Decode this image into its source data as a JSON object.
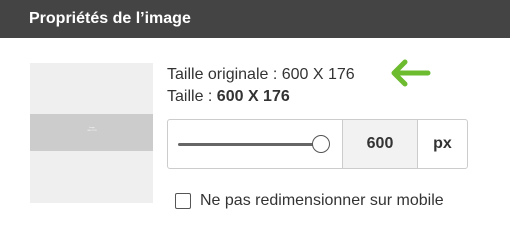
{
  "dialog": {
    "title": "Propriétés de l’image"
  },
  "preview": {
    "line1": "Image",
    "line2": "600 X 176"
  },
  "original_size": {
    "text": "Taille originale : 600 X 176"
  },
  "size": {
    "label": "Taille : ",
    "value": "600 X 176"
  },
  "resize": {
    "slider_level": 1.0,
    "width_value": "600",
    "unit": "px"
  },
  "mobile_option": {
    "label": "Ne pas redimensionner sur mobile",
    "checked": false
  },
  "colors": {
    "header_bg": "#444444",
    "arrow": "#6dbb2f",
    "thumbnail_bg": "#efefef",
    "thumbnail_band": "#cccccc"
  },
  "icons": {
    "pointer": "arrow-left-icon",
    "slider": "slider-handle-icon"
  }
}
